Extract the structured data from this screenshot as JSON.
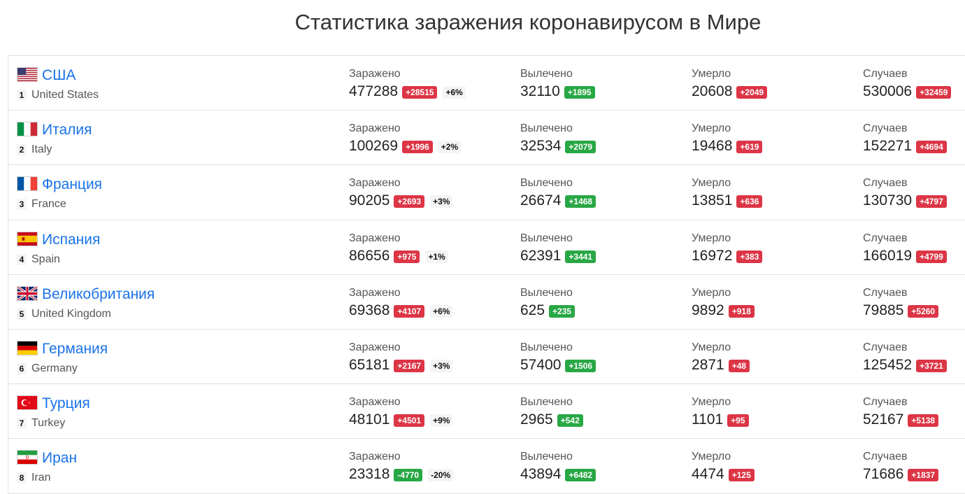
{
  "page_title": "Статистика заражения коронавирусом в Мире",
  "labels": {
    "infected": "Заражено",
    "recovered": "Вылечено",
    "deaths": "Умерло",
    "cases": "Случаев"
  },
  "colors": {
    "link": "#1a73e8",
    "badge_red": "#dc3545",
    "badge_green": "#28a745"
  },
  "countries": [
    {
      "rank": "1",
      "name": "США",
      "name_en": "United States",
      "flag": "us-flag-icon",
      "infected": "477288",
      "infected_delta": "+28515",
      "infected_pct": "+6%",
      "recovered": "32110",
      "recovered_delta": "+1895",
      "deaths": "20608",
      "deaths_delta": "+2049",
      "cases": "530006",
      "cases_delta": "+32459"
    },
    {
      "rank": "2",
      "name": "Италия",
      "name_en": "Italy",
      "flag": "italy-flag-icon",
      "infected": "100269",
      "infected_delta": "+1996",
      "infected_pct": "+2%",
      "recovered": "32534",
      "recovered_delta": "+2079",
      "deaths": "19468",
      "deaths_delta": "+619",
      "cases": "152271",
      "cases_delta": "+4694"
    },
    {
      "rank": "3",
      "name": "Франция",
      "name_en": "France",
      "flag": "france-flag-icon",
      "infected": "90205",
      "infected_delta": "+2693",
      "infected_pct": "+3%",
      "recovered": "26674",
      "recovered_delta": "+1468",
      "deaths": "13851",
      "deaths_delta": "+636",
      "cases": "130730",
      "cases_delta": "+4797"
    },
    {
      "rank": "4",
      "name": "Испания",
      "name_en": "Spain",
      "flag": "spain-flag-icon",
      "infected": "86656",
      "infected_delta": "+975",
      "infected_pct": "+1%",
      "recovered": "62391",
      "recovered_delta": "+3441",
      "deaths": "16972",
      "deaths_delta": "+383",
      "cases": "166019",
      "cases_delta": "+4799"
    },
    {
      "rank": "5",
      "name": "Великобритания",
      "name_en": "United Kingdom",
      "flag": "uk-flag-icon",
      "infected": "69368",
      "infected_delta": "+4107",
      "infected_pct": "+6%",
      "recovered": "625",
      "recovered_delta": "+235",
      "deaths": "9892",
      "deaths_delta": "+918",
      "cases": "79885",
      "cases_delta": "+5260"
    },
    {
      "rank": "6",
      "name": "Германия",
      "name_en": "Germany",
      "flag": "germany-flag-icon",
      "infected": "65181",
      "infected_delta": "+2167",
      "infected_pct": "+3%",
      "recovered": "57400",
      "recovered_delta": "+1506",
      "deaths": "2871",
      "deaths_delta": "+48",
      "cases": "125452",
      "cases_delta": "+3721"
    },
    {
      "rank": "7",
      "name": "Турция",
      "name_en": "Turkey",
      "flag": "turkey-flag-icon",
      "infected": "48101",
      "infected_delta": "+4501",
      "infected_pct": "+9%",
      "recovered": "2965",
      "recovered_delta": "+542",
      "deaths": "1101",
      "deaths_delta": "+95",
      "cases": "52167",
      "cases_delta": "+5138"
    },
    {
      "rank": "8",
      "name": "Иран",
      "name_en": "Iran",
      "flag": "iran-flag-icon",
      "infected": "23318",
      "infected_delta": "-4770",
      "infected_delta_color": "green",
      "infected_pct": "-20%",
      "recovered": "43894",
      "recovered_delta": "+6482",
      "deaths": "4474",
      "deaths_delta": "+125",
      "cases": "71686",
      "cases_delta": "+1837"
    }
  ]
}
